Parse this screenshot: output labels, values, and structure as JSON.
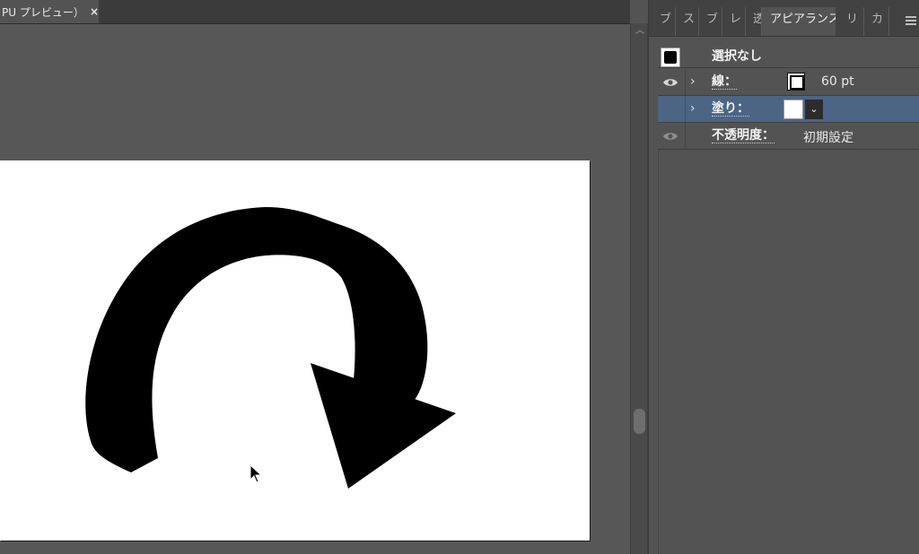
{
  "document_tab": {
    "title": "PU プレビュー）",
    "close": "×"
  },
  "panel_tabs": [
    {
      "label": "ブ"
    },
    {
      "label": "ス"
    },
    {
      "label": "ブ"
    },
    {
      "label": "レ"
    },
    {
      "label": "透"
    },
    {
      "label": "アピアランス",
      "active": true
    },
    {
      "label": "リ"
    },
    {
      "label": "カ"
    }
  ],
  "appearance": {
    "header": {
      "label": "選択なし"
    },
    "stroke": {
      "label": "線：",
      "value": "60 pt",
      "swatch_color": "#000000"
    },
    "fill": {
      "label": "塗り：",
      "swatch_color": "#ffffff"
    },
    "opacity": {
      "label": "不透明度：",
      "value": "初期設定"
    }
  },
  "colors": {
    "app_background": "#535353",
    "selection_highlight": "#4c6585",
    "artboard": "#ffffff",
    "artwork": "#000000"
  },
  "icons": {
    "eye": "eye-icon",
    "chevron": "chevron-right-icon",
    "panel_menu": "menu-icon",
    "cursor": "pointer-cursor-icon"
  }
}
